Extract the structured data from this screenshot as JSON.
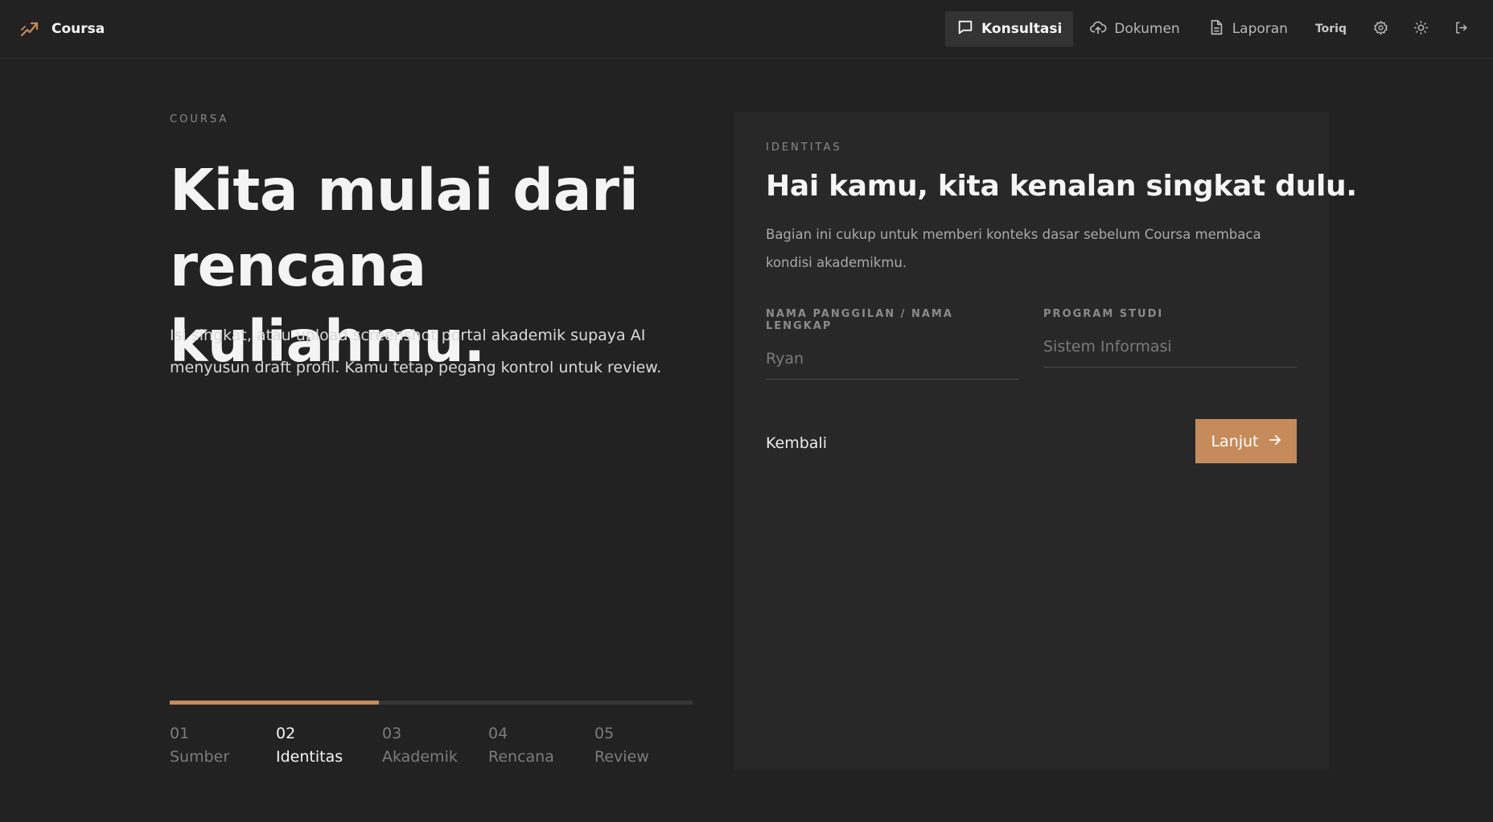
{
  "header": {
    "brand": "Coursa",
    "nav": [
      {
        "label": "Konsultasi",
        "icon": "chat-icon",
        "active": true
      },
      {
        "label": "Dokumen",
        "icon": "cloud-upload-icon",
        "active": false
      },
      {
        "label": "Laporan",
        "icon": "document-icon",
        "active": false
      }
    ],
    "user": "Toriq",
    "icons": [
      "gear-icon",
      "sun-icon",
      "logout-icon"
    ]
  },
  "hero": {
    "eyebrow": "COURSA",
    "title": "Kita mulai dari rencana kuliahmu.",
    "description": "Isi singkat, atau upload screenshot portal akademik supaya AI menyusun draft profil. Kamu tetap pegang kontrol untuk review."
  },
  "stepper": {
    "progress_percent": 40,
    "steps": [
      {
        "num": "01",
        "label": "Sumber"
      },
      {
        "num": "02",
        "label": "Identitas"
      },
      {
        "num": "03",
        "label": "Akademik"
      },
      {
        "num": "04",
        "label": "Rencana"
      },
      {
        "num": "05",
        "label": "Review"
      }
    ],
    "current_index": 1
  },
  "form": {
    "eyebrow": "IDENTITAS",
    "title": "Hai kamu, kita kenalan singkat dulu.",
    "description": "Bagian ini cukup untuk memberi konteks dasar sebelum Coursa membaca kondisi akademikmu.",
    "name_label": "NAMA PANGGILAN / NAMA LENGKAP",
    "name_placeholder": "Ryan",
    "name_value": "",
    "program_label": "PROGRAM STUDI",
    "program_placeholder": "Sistem Informasi",
    "program_value": "",
    "back_label": "Kembali",
    "next_label": "Lanjut"
  },
  "colors": {
    "accent": "#c68b5a",
    "background": "#222222",
    "card": "#282828"
  }
}
